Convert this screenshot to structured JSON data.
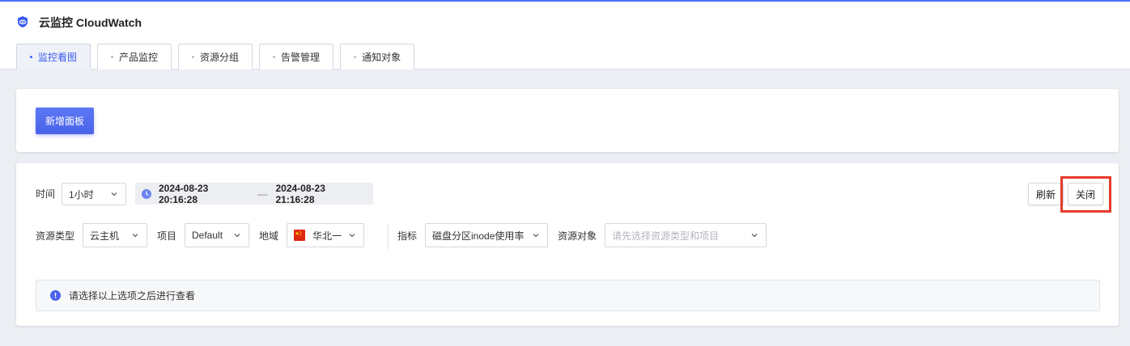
{
  "app": {
    "title": "云监控 CloudWatch"
  },
  "tabs": [
    {
      "label": "监控看图",
      "active": true
    },
    {
      "label": "产品监控",
      "active": false
    },
    {
      "label": "资源分组",
      "active": false
    },
    {
      "label": "告警管理",
      "active": false
    },
    {
      "label": "通知对象",
      "active": false
    }
  ],
  "toolbar": {
    "add_panel_label": "新增面板"
  },
  "time": {
    "label": "时间",
    "range_value": "1小时",
    "start": "2024-08-23 20:16:28",
    "separator": "—",
    "end": "2024-08-23 21:16:28"
  },
  "actions": {
    "refresh_label": "刷新",
    "close_label": "关闭"
  },
  "filters": {
    "resource_type": {
      "label": "资源类型",
      "value": "云主机"
    },
    "project": {
      "label": "项目",
      "value": "Default"
    },
    "region": {
      "label": "地域",
      "value": "华北一",
      "flag_icon": "china-flag-icon"
    },
    "metric": {
      "label": "指标",
      "value": "磁盘分区inode使用率"
    },
    "resource_object": {
      "label": "资源对象",
      "placeholder": "请先选择资源类型和项目"
    }
  },
  "notice": {
    "text": "请选择以上选项之后进行查看",
    "icon": "info-icon"
  },
  "colors": {
    "accent": "#3a5bf0",
    "primary_button": "#4a63ea",
    "highlight": "#e53b2c",
    "page_bg": "#eceef3"
  }
}
